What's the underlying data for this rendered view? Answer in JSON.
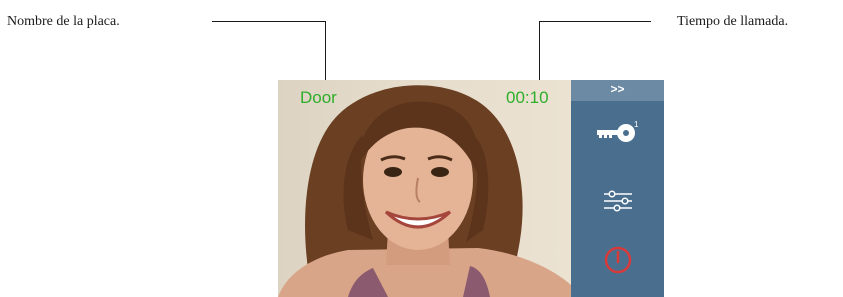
{
  "callouts": {
    "left": "Nombre de la placa.",
    "right": "Tiempo de llamada."
  },
  "screen": {
    "door_name": "Door",
    "call_time": "00:10",
    "sidebar": {
      "expand_label": ">>",
      "buttons": [
        {
          "icon": "key-icon",
          "badge": "1"
        },
        {
          "icon": "settings-sliders-icon"
        },
        {
          "icon": "power-icon"
        }
      ]
    }
  },
  "colors": {
    "overlay_text": "#2fae2b",
    "sidebar": "#4a6f8e",
    "sidebar_top": "#6c8aa3",
    "power_icon": "#d83a3a"
  }
}
